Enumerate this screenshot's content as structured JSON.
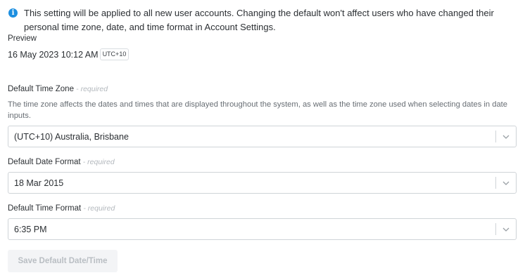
{
  "info": {
    "icon": "info-icon",
    "color": "#1d8fe0",
    "text": "This setting will be applied to all new user accounts. Changing the default won't affect users who have changed their personal time zone, date, and time format in Account Settings."
  },
  "preview": {
    "label": "Preview",
    "value": "16 May 2023 10:12 AM",
    "tz_badge": "UTC+10"
  },
  "time_zone": {
    "label": "Default Time Zone",
    "required": "- required",
    "description": "The time zone affects the dates and times that are displayed throughout the system, as well as the time zone used when selecting dates in date inputs.",
    "value": "(UTC+10) Australia, Brisbane"
  },
  "date_format": {
    "label": "Default Date Format",
    "required": "- required",
    "value": "18 Mar 2015"
  },
  "time_format": {
    "label": "Default Time Format",
    "required": "- required",
    "value": "6:35 PM"
  },
  "save_button": {
    "label": "Save Default Date/Time"
  }
}
